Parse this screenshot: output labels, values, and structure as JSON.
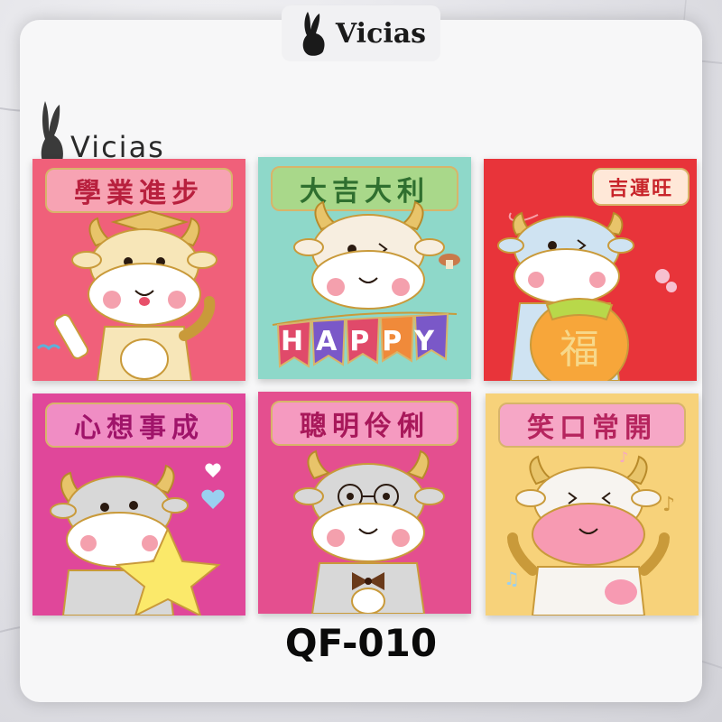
{
  "brand": {
    "top_logo_text": "Vicias",
    "corner_logo_text": "Vicias"
  },
  "product_code": "QF-010",
  "envelopes": [
    {
      "title": "學業進步",
      "bg": "#f0607a",
      "title_bg": "#f7a3b3",
      "title_color": "#b8203e"
    },
    {
      "title": "大吉大利",
      "bg": "#8ed8c9",
      "title_bg": "#a9d88a",
      "title_color": "#2f6f2f",
      "banner": "HAPPY"
    },
    {
      "title": "吉運旺",
      "bg": "#e8343a",
      "title_bg": "#ffe8d8",
      "title_color": "#c8242a",
      "belly_text": "福"
    },
    {
      "title": "心想事成",
      "bg": "#e0479a",
      "title_bg": "#f08dc4",
      "title_color": "#a0146a"
    },
    {
      "title": "聰明伶俐",
      "bg": "#e44f8f",
      "title_bg": "#f59ac0",
      "title_color": "#a8185a"
    },
    {
      "title": "笑口常開",
      "bg": "#f7d27a",
      "title_bg": "#f6a7c6",
      "title_color": "#b6245e"
    }
  ],
  "colors": {
    "gold_outline": "#d8b46a",
    "ox_body": "#f4f0ea",
    "ox_cheek": "#f4a0ad"
  }
}
